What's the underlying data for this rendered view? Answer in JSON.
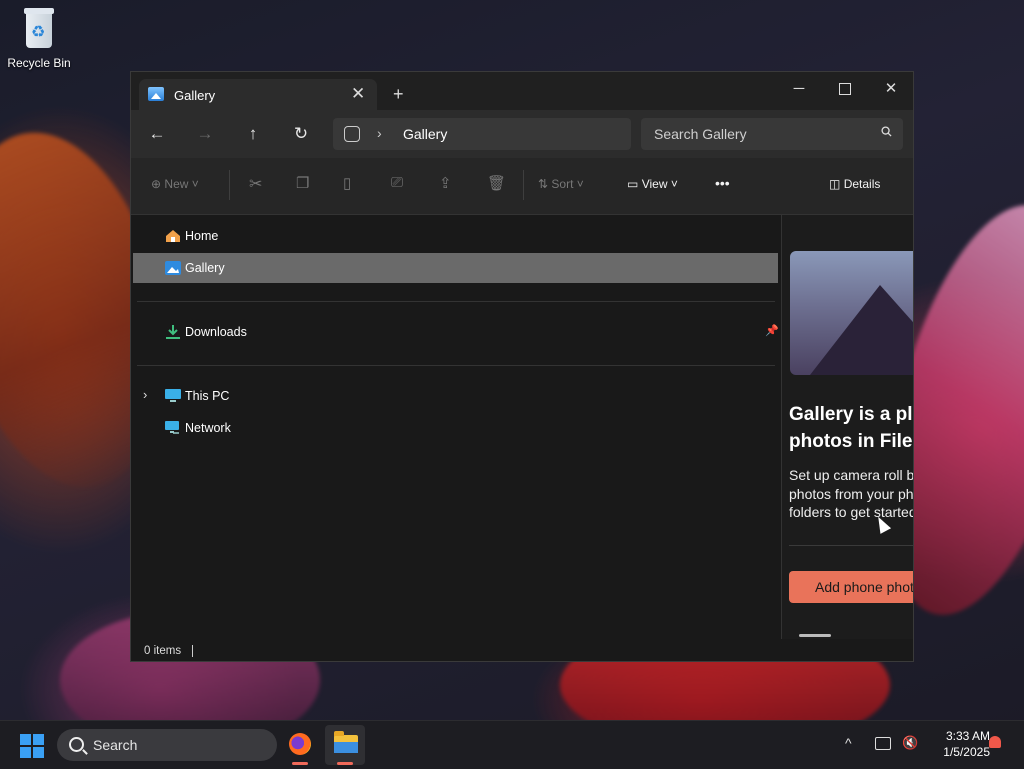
{
  "desktop": {
    "icons": [
      {
        "label": "Recycle Bin",
        "icon": "recycle-bin-icon"
      }
    ]
  },
  "window": {
    "tab": {
      "title": "Gallery",
      "icon": "gallery-icon"
    },
    "controls": {
      "minimize": "─",
      "close": "✕",
      "new_tab": "+"
    },
    "nav": {
      "back": "←",
      "forward": "→",
      "up": "↑",
      "refresh": "↻"
    },
    "address": {
      "chevron": "›",
      "location": "Gallery"
    },
    "search": {
      "placeholder": "Search Gallery"
    },
    "toolbar": {
      "new_label": "New",
      "sort_label": "Sort",
      "view_label": "View",
      "more": "•••",
      "details_label": "Details"
    },
    "nav_pane": {
      "home": "Home",
      "gallery": "Gallery",
      "downloads": "Downloads",
      "this_pc": "This PC",
      "network": "Network",
      "expand": "›",
      "pin": "📌"
    },
    "details_pane": {
      "title": "Gallery is a place to see photos in File Explorer",
      "description": "Set up camera roll backup to see photos from your phone here. Or, add folders to get started.",
      "button_label": "Add phone photos"
    },
    "status": {
      "items": "0 items"
    }
  },
  "taskbar": {
    "search_label": "Search",
    "apps": [
      {
        "name": "Firefox",
        "icon": "firefox-icon"
      },
      {
        "name": "File Explorer",
        "icon": "file-explorer-icon"
      }
    ],
    "tray_chevron": "^",
    "clock": {
      "time": "3:33 AM",
      "date": "1/5/2025"
    }
  },
  "colors": {
    "accent": "#e9735a",
    "selected_bg": "#6a6a6a",
    "window_bg": "#191919",
    "start_blue": "#3aa0f5"
  }
}
